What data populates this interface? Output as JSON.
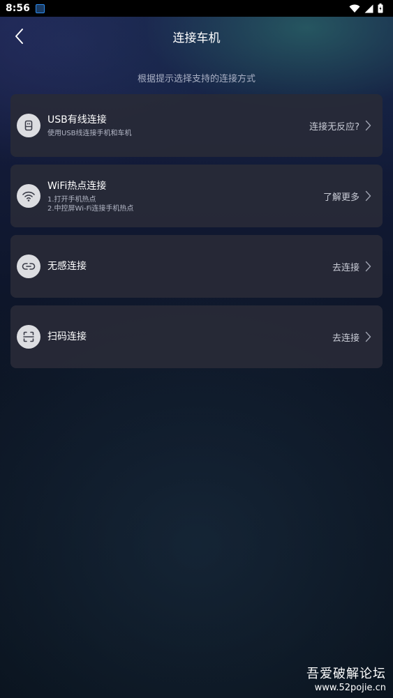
{
  "status_bar": {
    "time": "8:56",
    "icons": [
      "app-notification-icon",
      "wifi-icon",
      "signal-icon",
      "battery-icon"
    ]
  },
  "header": {
    "title": "连接车机",
    "back_icon": "chevron-left-icon"
  },
  "hint": "根据提示选择支持的连接方式",
  "connections": [
    {
      "icon": "usb-icon",
      "title": "USB有线连接",
      "subtitle_lines": [
        "使用USB线连接手机和车机"
      ],
      "action": "连接无反应?"
    },
    {
      "icon": "wifi-icon",
      "title": "WiFi热点连接",
      "subtitle_lines": [
        "1.打开手机热点",
        "2.中控屏Wi-Fi连接手机热点"
      ],
      "action": "了解更多"
    },
    {
      "icon": "link-icon",
      "title": "无感连接",
      "subtitle_lines": [],
      "action": "去连接"
    },
    {
      "icon": "scan-icon",
      "title": "扫码连接",
      "subtitle_lines": [],
      "action": "去连接"
    }
  ],
  "watermark": {
    "title": "吾爱破解论坛",
    "url": "www.52pojie.cn"
  },
  "colors": {
    "card_bg": "#282a37",
    "icon_bg": "#dcdde1",
    "text_secondary": "#b3b7c6",
    "status_bar": "#000000"
  }
}
